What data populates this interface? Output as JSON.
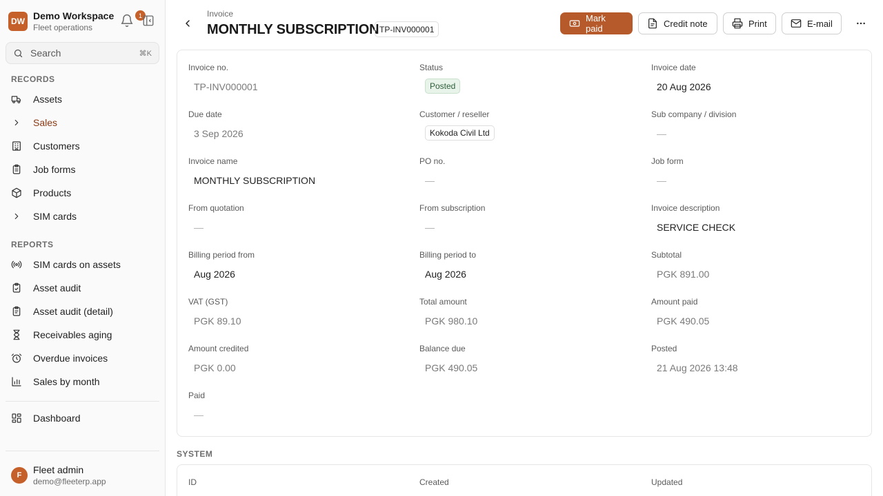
{
  "workspace": {
    "initials": "DW",
    "name": "Demo Workspace",
    "subtitle": "Fleet operations",
    "notifications": "1"
  },
  "search": {
    "placeholder": "Search",
    "shortcut": "⌘K"
  },
  "sidebar": {
    "records_label": "RECORDS",
    "records": [
      {
        "label": "Assets",
        "icon": "truck-icon"
      },
      {
        "label": "Sales",
        "icon": "chevron-right-icon"
      },
      {
        "label": "Customers",
        "icon": "building-icon"
      },
      {
        "label": "Job forms",
        "icon": "clipboard-icon"
      },
      {
        "label": "Products",
        "icon": "package-icon"
      },
      {
        "label": "SIM cards",
        "icon": "chevron-right-icon"
      }
    ],
    "reports_label": "REPORTS",
    "reports": [
      {
        "label": "SIM cards on assets",
        "icon": "signal-icon"
      },
      {
        "label": "Asset audit",
        "icon": "clipboard-check-icon"
      },
      {
        "label": "Asset audit (detail)",
        "icon": "clipboard-list-icon"
      },
      {
        "label": "Receivables aging",
        "icon": "hourglass-icon"
      },
      {
        "label": "Overdue invoices",
        "icon": "alarm-clock-icon"
      },
      {
        "label": "Sales by month",
        "icon": "bar-chart-icon"
      }
    ],
    "dashboard": {
      "label": "Dashboard",
      "icon": "dashboard-icon"
    }
  },
  "user": {
    "initial": "F",
    "name": "Fleet admin",
    "email": "demo@fleeterp.app"
  },
  "header": {
    "breadcrumb": "Invoice",
    "title": "MONTHLY SUBSCRIPTION",
    "invoice_id": "TP-INV000001"
  },
  "actions": {
    "mark_paid": "Mark paid",
    "credit_note": "Credit note",
    "print": "Print",
    "email": "E-mail"
  },
  "fields": {
    "invoice_no": {
      "label": "Invoice no.",
      "value": "TP-INV000001"
    },
    "status": {
      "label": "Status",
      "value": "Posted"
    },
    "invoice_date": {
      "label": "Invoice date",
      "value": "20 Aug 2026"
    },
    "due_date": {
      "label": "Due date",
      "value": "3 Sep 2026"
    },
    "customer": {
      "label": "Customer / reseller",
      "value": "Kokoda Civil Ltd"
    },
    "sub_company": {
      "label": "Sub company / division",
      "value": "—"
    },
    "invoice_name": {
      "label": "Invoice name",
      "value": "MONTHLY SUBSCRIPTION"
    },
    "po_no": {
      "label": "PO no.",
      "value": "—"
    },
    "job_form": {
      "label": "Job form",
      "value": "—"
    },
    "from_quotation": {
      "label": "From quotation",
      "value": "—"
    },
    "from_subscription": {
      "label": "From subscription",
      "value": "—"
    },
    "invoice_description": {
      "label": "Invoice description",
      "value": "SERVICE CHECK"
    },
    "billing_from": {
      "label": "Billing period from",
      "value": "Aug 2026"
    },
    "billing_to": {
      "label": "Billing period to",
      "value": "Aug 2026"
    },
    "subtotal": {
      "label": "Subtotal",
      "value": "PGK 891.00"
    },
    "vat": {
      "label": "VAT (GST)",
      "value": "PGK 89.10"
    },
    "total_amount": {
      "label": "Total amount",
      "value": "PGK 980.10"
    },
    "amount_paid": {
      "label": "Amount paid",
      "value": "PGK 490.05"
    },
    "amount_credited": {
      "label": "Amount credited",
      "value": "PGK 0.00"
    },
    "balance_due": {
      "label": "Balance due",
      "value": "PGK 490.05"
    },
    "posted": {
      "label": "Posted",
      "value": "21 Aug 2026 13:48"
    },
    "paid": {
      "label": "Paid",
      "value": "—"
    }
  },
  "system": {
    "label": "SYSTEM",
    "id_label": "ID",
    "created_label": "Created",
    "updated_label": "Updated"
  },
  "colors": {
    "accent": "#b75a2b",
    "status_bg": "#e8f3ea"
  }
}
